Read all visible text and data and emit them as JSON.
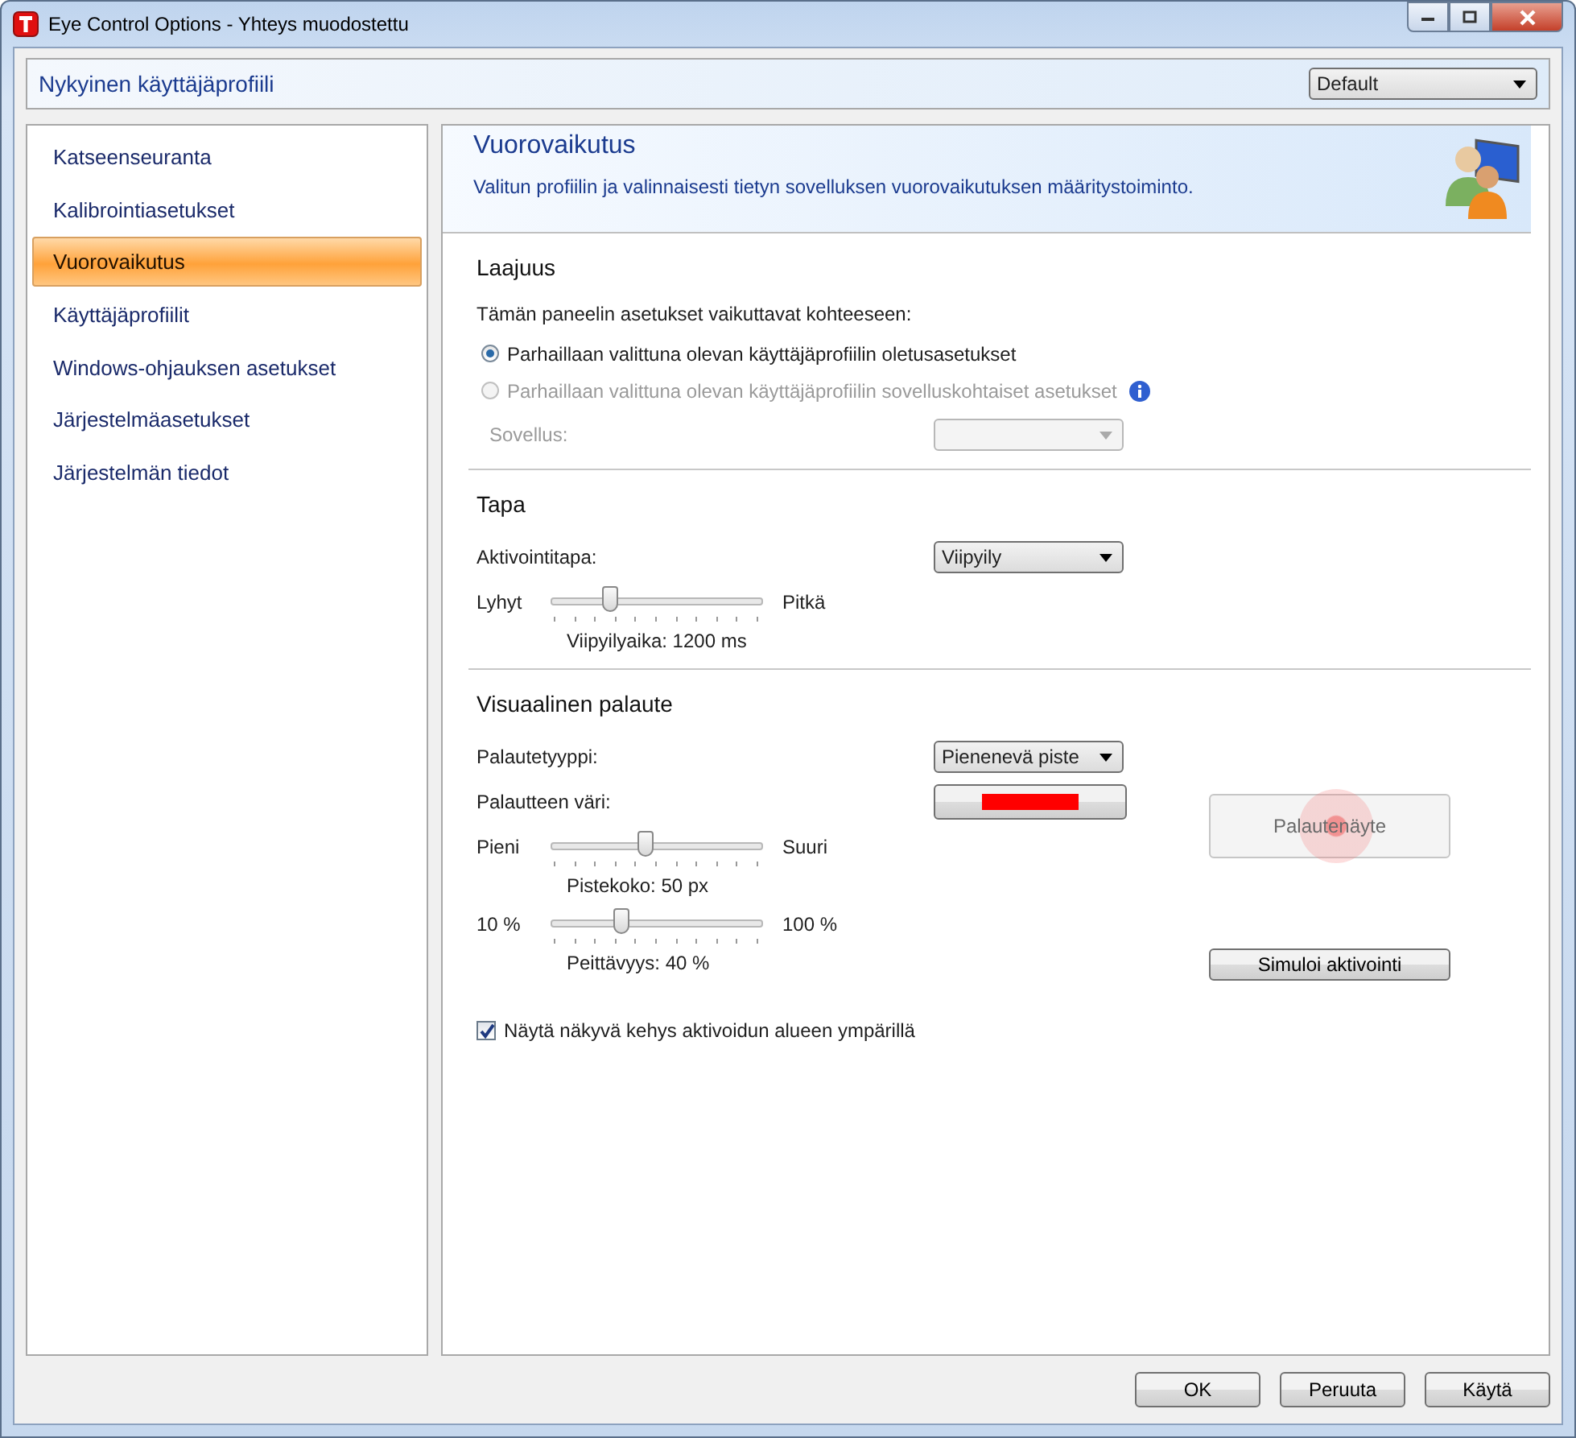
{
  "window": {
    "title": "Eye Control Options - Yhteys muodostettu"
  },
  "profile_bar": {
    "label": "Nykyinen käyttäjäprofiili",
    "dropdown": "Default"
  },
  "sidebar": {
    "items": [
      {
        "label": "Katseenseuranta",
        "selected": false
      },
      {
        "label": "Kalibrointiasetukset",
        "selected": false
      },
      {
        "label": "Vuorovaikutus",
        "selected": true
      },
      {
        "label": "Käyttäjäprofiilit",
        "selected": false
      },
      {
        "label": "Windows-ohjauksen asetukset",
        "selected": false
      },
      {
        "label": "Järjestelmäasetukset",
        "selected": false
      },
      {
        "label": "Järjestelmän tiedot",
        "selected": false
      }
    ]
  },
  "panel": {
    "title": "Vuorovaikutus",
    "description": "Valitun profiilin ja valinnaisesti tietyn sovelluksen vuorovaikutuksen määritystoiminto.",
    "scope": {
      "heading": "Laajuus",
      "prompt": "Tämän paneelin asetukset vaikuttavat kohteeseen:",
      "options": [
        {
          "label": "Parhaillaan valittuna olevan käyttäjäprofiilin oletusasetukset",
          "selected": true,
          "disabled": false,
          "info": false
        },
        {
          "label": "Parhaillaan valittuna olevan käyttäjäprofiilin sovelluskohtaiset asetukset",
          "selected": false,
          "disabled": true,
          "info": true
        }
      ],
      "application": {
        "label": "Sovellus:",
        "disabled": true
      }
    },
    "method": {
      "heading": "Tapa",
      "activation_label": "Aktivointitapa:",
      "activation_value": "Viipyily",
      "slider": {
        "min_label": "Lyhyt",
        "max_label": "Pitkä",
        "level": 0.28,
        "reading": "Viipyilyaika: 1200 ms"
      }
    },
    "feedback": {
      "heading": "Visuaalinen palaute",
      "type_label": "Palautetyyppi:",
      "type_value": "Pienenevä piste",
      "color_label": "Palautteen väri:",
      "color": "#ff0000",
      "sliders": [
        {
          "min_label": "Pieni",
          "max_label": "Suuri",
          "level": 0.45,
          "reading": "Pistekoko: 50 px"
        },
        {
          "min_label": "10 %",
          "max_label": "100 %",
          "level": 0.33,
          "reading": "Peittävyys: 40 %"
        }
      ],
      "preview_button": {
        "label": "Palautenäyte",
        "disabled": true
      },
      "simulate_button": {
        "label": "Simuloi aktivointi"
      },
      "checkbox": {
        "label": "Näytä näkyvä kehys aktivoidun alueen ympärillä",
        "checked": true
      }
    }
  },
  "buttons": [
    {
      "label": "OK"
    },
    {
      "label": "Peruuta"
    },
    {
      "label": "Käytä"
    }
  ]
}
